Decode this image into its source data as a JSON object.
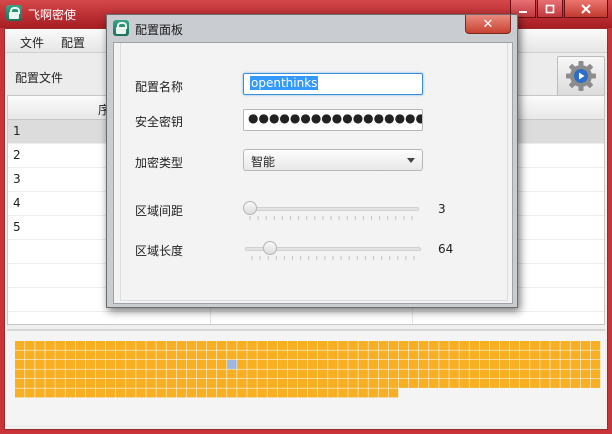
{
  "main_window": {
    "title": "飞啊密使",
    "menu": [
      "文件",
      "配置"
    ],
    "toolbar_label": "配置文件",
    "icons": {
      "app": "lock-icon",
      "settings": "gear-icon"
    }
  },
  "table": {
    "header_first_char": "序",
    "rows": [
      "1",
      "2",
      "3",
      "4",
      "5"
    ],
    "selected_row_index": 0
  },
  "grid": {
    "colors": {
      "filled": "#f8b022",
      "highlight": "#9db7de",
      "empty": "#f4f4f4"
    },
    "columns": 58,
    "rows": 6,
    "last_row_filled_columns": 38,
    "highlight_cell": {
      "row": 2,
      "col": 21
    }
  },
  "dialog": {
    "title": "配置面板",
    "close_glyph": "✕",
    "fields": {
      "name": {
        "label": "配置名称",
        "value": "openthinks"
      },
      "key": {
        "label": "安全密钥",
        "value": "●●●●●●●●●●●●●●●●●●●●●●●●"
      },
      "type": {
        "label": "加密类型",
        "value": "智能"
      },
      "spacing": {
        "label": "区域间距",
        "value": "3",
        "fraction": 0.0
      },
      "length": {
        "label": "区域长度",
        "value": "64",
        "fraction": 0.11
      }
    }
  }
}
